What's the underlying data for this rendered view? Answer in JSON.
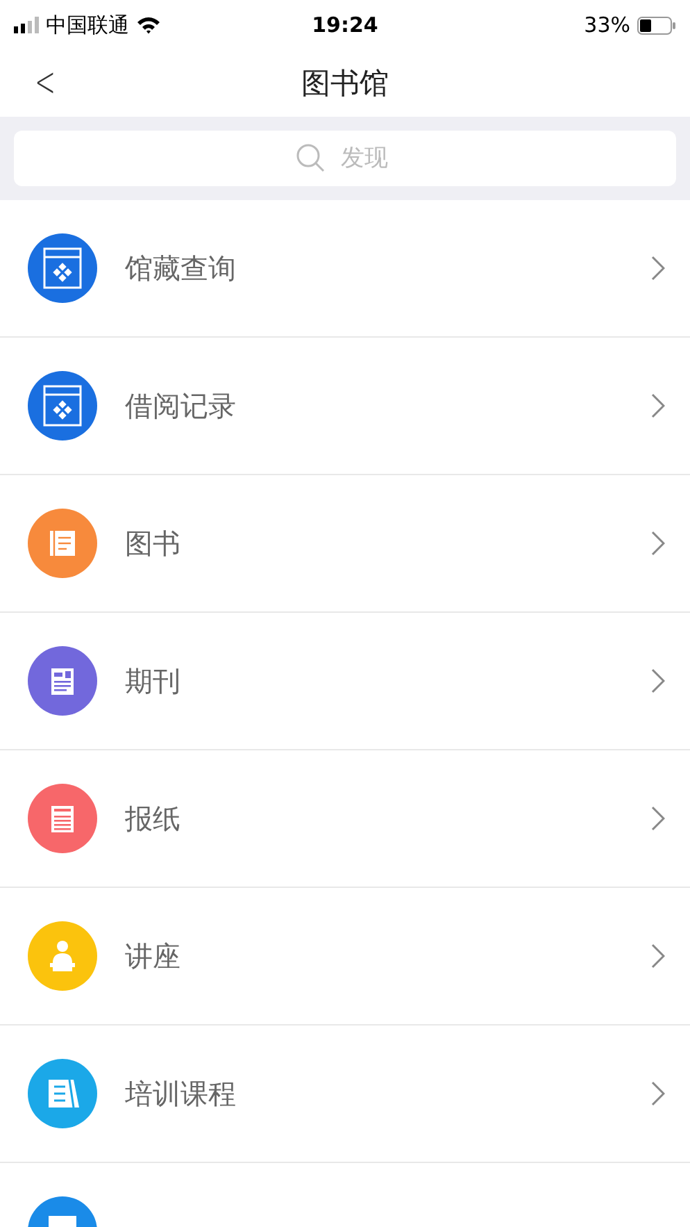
{
  "status_bar": {
    "carrier": "中国联通",
    "time": "19:24",
    "battery": "33%"
  },
  "nav": {
    "back": "<",
    "title": "图书馆"
  },
  "search": {
    "placeholder": "发现"
  },
  "items": [
    {
      "label": "馆藏查询",
      "kind": "window",
      "color": "#1a6fe0"
    },
    {
      "label": "借阅记录",
      "kind": "window",
      "color": "#1a6fe0"
    },
    {
      "label": "图书",
      "kind": "book",
      "color": "#f78a3c"
    },
    {
      "label": "期刊",
      "kind": "magazine",
      "color": "#7268dc"
    },
    {
      "label": "报纸",
      "kind": "newspaper",
      "color": "#f7676a"
    },
    {
      "label": "讲座",
      "kind": "lecture",
      "color": "#fbc30d"
    },
    {
      "label": "培训课程",
      "kind": "course",
      "color": "#1ba8e8"
    },
    {
      "kind": "partial",
      "color": "#1a8be8"
    }
  ]
}
